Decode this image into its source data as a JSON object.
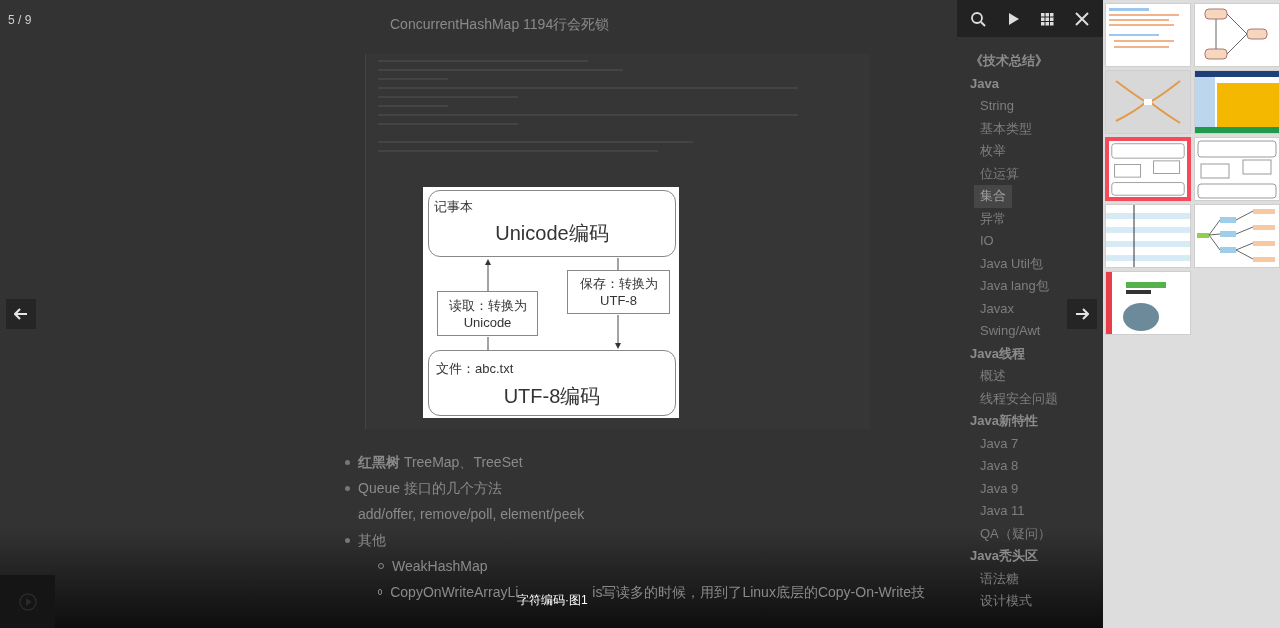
{
  "counter": "5 / 9",
  "toolbar": {
    "buttons": [
      {
        "kind": "search"
      },
      {
        "kind": "play"
      },
      {
        "kind": "grid"
      },
      {
        "kind": "close"
      }
    ]
  },
  "viewer": {
    "diagram": {
      "top_box": {
        "label": "记事本",
        "title": "Unicode编码"
      },
      "read_box": [
        "读取：转换为",
        "Unicode"
      ],
      "save_box": [
        "保存：转换为",
        "UTF-8"
      ],
      "bottom_box": {
        "label": "文件：abc.txt",
        "title": "UTF-8编码"
      }
    },
    "caption": "字符编码·图1"
  },
  "background_page": {
    "article": {
      "title": "ConcurrentHashMap 1194行会死锁",
      "list": [
        {
          "text": "**红黑树** TreeMap、TreeSet"
        },
        {
          "text": "Queue 接口的几个方法",
          "note": "add/offer, remove/poll, element/peek"
        },
        {
          "text": "其他",
          "children": [
            {
              "parts": [
                "WeakHashMap"
              ]
            },
            {
              "parts": [
                "CopyOnWriteArrayLi",
                "is写读多的时候，用到了Linux底层的Copy-On-Write技"
              ]
            }
          ]
        }
      ]
    },
    "catalog": {
      "items": [
        {
          "label": "《技术总结》"
        },
        {
          "label": "Java",
          "children": [
            {
              "label": "String",
              "selected": false
            },
            {
              "label": "基本类型",
              "selected": false
            },
            {
              "label": "枚举",
              "selected": false
            },
            {
              "label": "位运算",
              "selected": false
            },
            {
              "label": "集合",
              "selected": true
            },
            {
              "label": "异常",
              "selected": false
            },
            {
              "label": "IO",
              "selected": false
            },
            {
              "label": "Java Util包",
              "selected": false
            },
            {
              "label": "Java lang包",
              "selected": false
            },
            {
              "label": "Javax",
              "selected": false
            },
            {
              "label": "Swing/Awt",
              "selected": false
            }
          ]
        },
        {
          "label": "Java线程",
          "children": [
            {
              "label": "概述",
              "selected": false
            },
            {
              "label": "线程安全问题",
              "selected": false
            }
          ]
        },
        {
          "label": "Java新特性",
          "children": [
            {
              "label": "Java 7",
              "selected": false
            },
            {
              "label": "Java 8",
              "selected": false
            },
            {
              "label": "Java 9",
              "selected": false
            },
            {
              "label": "Java 11",
              "selected": false
            },
            {
              "label": "QA（疑问）",
              "selected": false
            }
          ]
        },
        {
          "label": "Java秃头区",
          "children": [
            {
              "label": "语法糖",
              "selected": false
            },
            {
              "label": "设计模式",
              "selected": false
            }
          ]
        }
      ]
    }
  },
  "thumbnails": [
    {
      "kind": "document",
      "selected": false
    },
    {
      "kind": "flowchart",
      "selected": false
    },
    {
      "kind": "mindmap",
      "selected": false
    },
    {
      "kind": "table",
      "selected": false
    },
    {
      "kind": "diagram",
      "selected": true
    },
    {
      "kind": "diagram",
      "selected": false
    },
    {
      "kind": "striped-table",
      "selected": false
    },
    {
      "kind": "tree",
      "selected": false
    },
    {
      "kind": "book-cover",
      "selected": false
    }
  ]
}
